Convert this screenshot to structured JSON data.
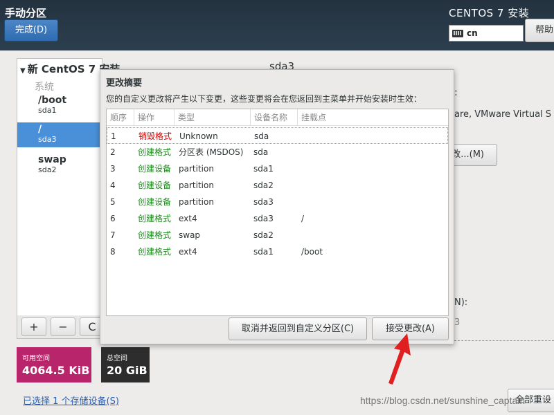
{
  "header": {
    "title": "手动分区",
    "done_label": "完成(D)",
    "product": "CENTOS 7 安装",
    "keyboard_layout": "cn",
    "help_label": "帮助"
  },
  "left_panel": {
    "os_heading": "新 CentOS 7 安装",
    "category": "系统",
    "items": [
      {
        "mount": "/boot",
        "device": "sda1"
      },
      {
        "mount": "/",
        "device": "sda3"
      },
      {
        "mount": "swap",
        "device": "sda2"
      }
    ],
    "toolbar": {
      "add": "+",
      "remove": "−",
      "refresh": "C"
    }
  },
  "space": {
    "available_label": "可用空间",
    "available_value": "4064.5 KiB",
    "total_label": "总空间",
    "total_value": "20 GiB"
  },
  "storage_link": "已选择 1 个存储设备(S)",
  "right_panel": {
    "title": "sda3",
    "colon": ":",
    "device_text": "are, VMware Virtual S",
    "modify_label": "改...(M)",
    "name_label": "N):",
    "value_3": "3",
    "reset_label": "全部重设"
  },
  "dialog": {
    "title": "更改摘要",
    "description": "您的自定义更改将产生以下变更，这些变更将会在您返回到主菜单并开始安装时生效：",
    "columns": [
      "顺序",
      "操作",
      "类型",
      "设备名称",
      "挂载点"
    ],
    "rows": [
      {
        "order": "1",
        "action": "销毁格式",
        "action_color": "#d40000",
        "type": "Unknown",
        "device": "sda",
        "mount": ""
      },
      {
        "order": "2",
        "action": "创建格式",
        "action_color": "#1a8a1a",
        "type": "分区表 (MSDOS)",
        "device": "sda",
        "mount": ""
      },
      {
        "order": "3",
        "action": "创建设备",
        "action_color": "#1a8a1a",
        "type": "partition",
        "device": "sda1",
        "mount": ""
      },
      {
        "order": "4",
        "action": "创建设备",
        "action_color": "#1a8a1a",
        "type": "partition",
        "device": "sda2",
        "mount": ""
      },
      {
        "order": "5",
        "action": "创建设备",
        "action_color": "#1a8a1a",
        "type": "partition",
        "device": "sda3",
        "mount": ""
      },
      {
        "order": "6",
        "action": "创建格式",
        "action_color": "#1a8a1a",
        "type": "ext4",
        "device": "sda3",
        "mount": "/"
      },
      {
        "order": "7",
        "action": "创建格式",
        "action_color": "#1a8a1a",
        "type": "swap",
        "device": "sda2",
        "mount": ""
      },
      {
        "order": "8",
        "action": "创建格式",
        "action_color": "#1a8a1a",
        "type": "ext4",
        "device": "sda1",
        "mount": "/boot"
      }
    ],
    "cancel_label": "取消并返回到自定义分区(C)",
    "accept_label": "接受更改(A)"
  },
  "watermark": "https://blog.csdn.net/sunshine_captain",
  "colors": {
    "header_bg": "#24323f",
    "accent_blue": "#4a90d9",
    "available_bg": "#b8256a",
    "total_bg": "#2d2d2d",
    "destroy_red": "#d40000",
    "create_green": "#1a8a1a",
    "arrow_red": "#e02020"
  }
}
